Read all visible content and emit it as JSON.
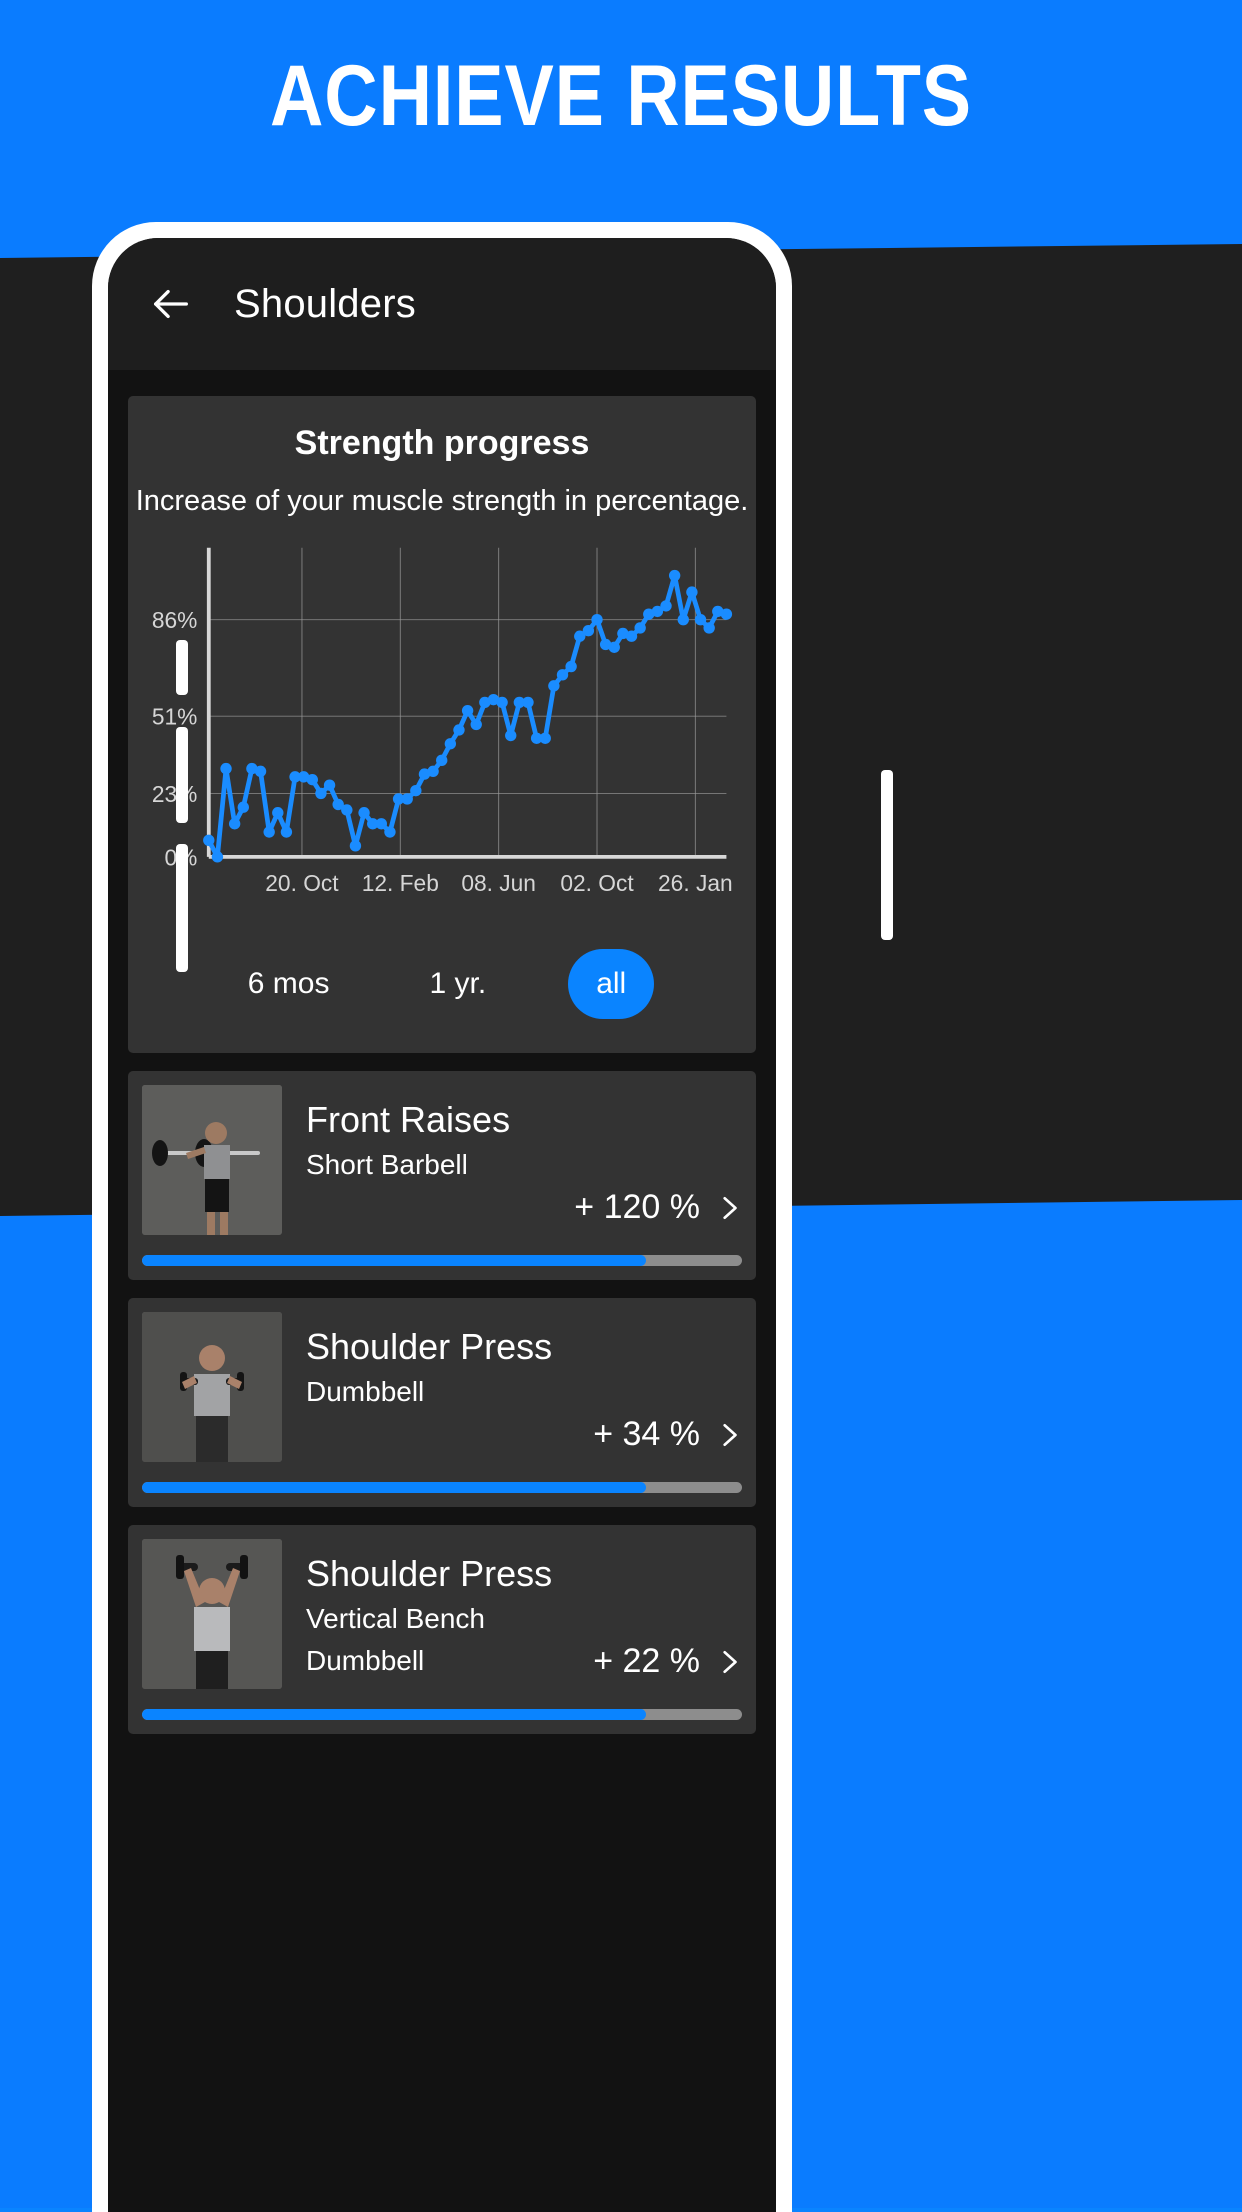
{
  "promo": {
    "headline": "ACHIEVE RESULTS",
    "accent_color": "#0a7cff",
    "band_color": "#1f1f1f"
  },
  "appbar": {
    "back_icon": "arrow-left-icon",
    "title": "Shoulders"
  },
  "chart_card": {
    "title": "Strength progress",
    "subtitle": "Increase of your muscle strength in percentage.",
    "ranges": [
      {
        "label": "6 mos",
        "active": false
      },
      {
        "label": "1 yr.",
        "active": false
      },
      {
        "label": "all",
        "active": true
      }
    ]
  },
  "chart_data": {
    "type": "line",
    "title": "Strength progress",
    "subtitle": "Increase of your muscle strength in percentage.",
    "xlabel": "",
    "ylabel": "",
    "unit": "%",
    "line_color": "#1a8cff",
    "grid": true,
    "grid_color": "#9a9a9a",
    "axis_color": "#d8d8d8",
    "ylim": [
      0,
      110
    ],
    "yticks": [
      0,
      23,
      51,
      86
    ],
    "ytick_labels": [
      "0%",
      "23%",
      "51%",
      "86%"
    ],
    "xtick_labels": [
      "20. Oct",
      "12. Feb",
      "08. Jun",
      "02. Oct",
      "26. Jan"
    ],
    "xtick_positions": [
      0.18,
      0.37,
      0.56,
      0.75,
      0.94
    ],
    "values": [
      6,
      0,
      32,
      12,
      18,
      32,
      31,
      9,
      16,
      9,
      29,
      29,
      28,
      23,
      26,
      19,
      17,
      4,
      16,
      12,
      12,
      9,
      21,
      21,
      24,
      30,
      31,
      35,
      41,
      46,
      53,
      48,
      56,
      57,
      56,
      44,
      56,
      56,
      43,
      43,
      62,
      66,
      69,
      80,
      82,
      86,
      77,
      76,
      81,
      80,
      83,
      88,
      89,
      91,
      102,
      86,
      96,
      86,
      83,
      89,
      88
    ]
  },
  "exercises": [
    {
      "name": "Front Raises",
      "equipment": "Short Barbell",
      "equipment2": "",
      "percent": "+ 120 %",
      "progress": 0.84,
      "thumb": "front-raises-photo",
      "chevron": "chevron-right-icon"
    },
    {
      "name": "Shoulder Press",
      "equipment": "Dumbbell",
      "equipment2": "",
      "percent": "+ 34 %",
      "progress": 0.84,
      "thumb": "shoulder-press-dumbbell-photo",
      "chevron": "chevron-right-icon"
    },
    {
      "name": "Shoulder Press",
      "equipment": "Vertical Bench",
      "equipment2": "Dumbbell",
      "percent": "+ 22 %",
      "progress": 0.84,
      "thumb": "shoulder-press-bench-photo",
      "chevron": "chevron-right-icon"
    }
  ]
}
